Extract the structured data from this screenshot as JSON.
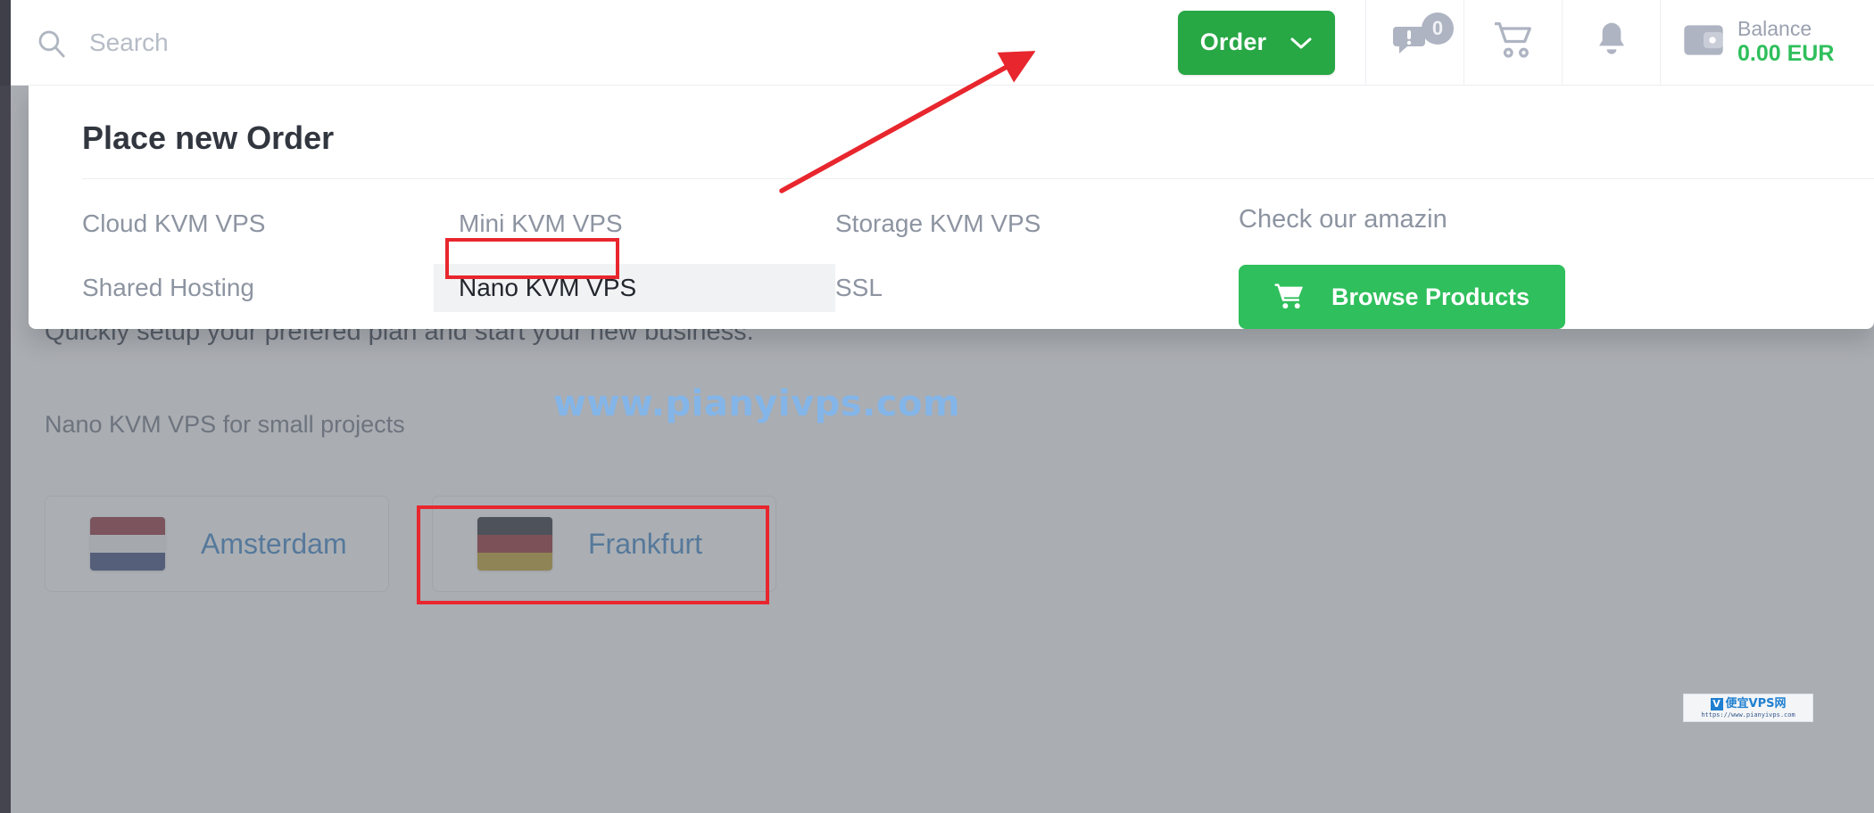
{
  "header": {
    "search": {
      "placeholder": "Search",
      "value": "",
      "icon": "search-icon"
    },
    "order_button": {
      "label": "Order",
      "caret_icon": "chevron-down-icon",
      "color": "#28a745"
    },
    "support": {
      "icon": "chat-alert-icon",
      "badge": "0"
    },
    "cart": {
      "icon": "shopping-cart-icon"
    },
    "notifications": {
      "icon": "bell-icon"
    },
    "balance": {
      "icon": "wallet-icon",
      "label": "Balance",
      "value": "0.00 EUR",
      "value_color": "#2fbf5c"
    }
  },
  "dropdown": {
    "title": "Place new Order",
    "columns": [
      {
        "items": [
          {
            "label": "Cloud KVM VPS",
            "hovered": false
          },
          {
            "label": "Shared Hosting",
            "hovered": false
          }
        ]
      },
      {
        "items": [
          {
            "label": "Mini KVM VPS",
            "hovered": false
          },
          {
            "label": "Nano KVM VPS",
            "hovered": true
          }
        ]
      },
      {
        "items": [
          {
            "label": "Storage KVM VPS",
            "hovered": false
          },
          {
            "label": "SSL",
            "hovered": false
          }
        ]
      }
    ],
    "promo": {
      "text": "Check our amazin",
      "button": {
        "label": "Browse Products",
        "icon": "shopping-cart-icon",
        "color": "#2fbf5c"
      }
    }
  },
  "page_behind": {
    "subtitle": "Quickly setup your prefered plan and start your new business.",
    "section_label": "Nano KVM VPS for small projects",
    "locations": [
      {
        "name": "Amsterdam",
        "flag": "netherlands-flag",
        "colors": [
          "#8c2f3d",
          "#e8eaee",
          "#38477a"
        ],
        "selected": false
      },
      {
        "name": "Frankfurt",
        "flag": "germany-flag",
        "colors": [
          "#282b33",
          "#8e2a30",
          "#b89a2a"
        ],
        "selected": true
      }
    ]
  },
  "watermarks": {
    "center_text": "www.pianyivps.com",
    "logo": {
      "badge": "V",
      "name": "便宜VPS网",
      "url": "https://www.pianyivps.com"
    }
  },
  "annotations": {
    "color": "#e8262d",
    "items": [
      {
        "name": "nano-kvm-vps-highlight",
        "kind": "box"
      },
      {
        "name": "frankfurt-card-highlight",
        "kind": "box"
      },
      {
        "name": "order-button-pointer",
        "kind": "arrow"
      }
    ]
  }
}
